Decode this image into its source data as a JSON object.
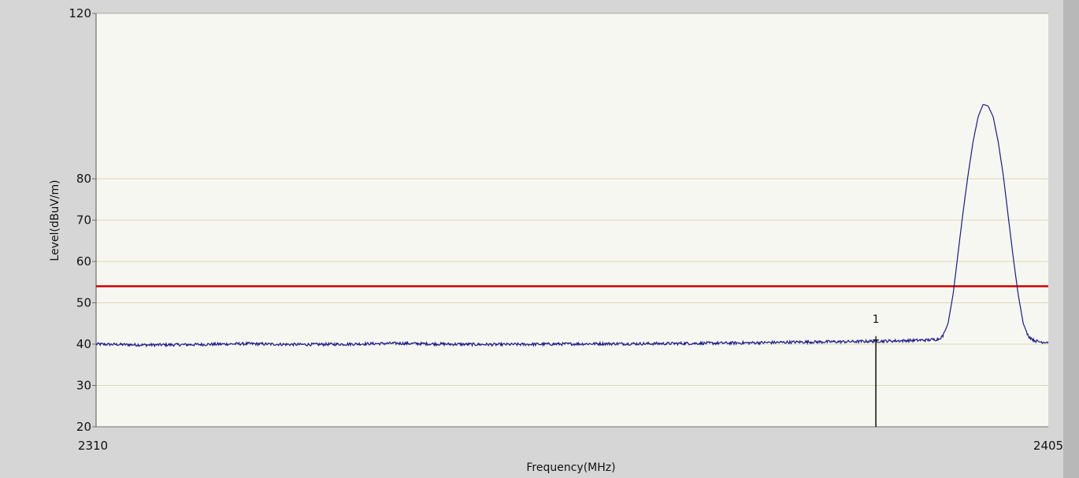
{
  "chart_data": {
    "type": "line",
    "title": "",
    "xlabel": "Frequency(MHz)",
    "ylabel": "Level(dBuV/m)",
    "xlim": [
      2310,
      2405
    ],
    "ylim": [
      20,
      120
    ],
    "x_ticks": [
      "2310",
      "2405"
    ],
    "y_ticks": [
      20,
      30,
      40,
      50,
      60,
      70,
      80,
      120
    ],
    "y_tick_labels": [
      "20",
      "30",
      "40",
      "50",
      "60",
      "70",
      "80",
      "120"
    ],
    "grid": true,
    "limit_line": {
      "y": 54,
      "color": "#cc0000"
    },
    "series": [
      {
        "color": "#1a1a8c",
        "x": [
          2310,
          2315,
          2320,
          2325,
          2330,
          2335,
          2340,
          2345,
          2350,
          2355,
          2360,
          2365,
          2370,
          2375,
          2380,
          2385,
          2390,
          2393,
          2394,
          2394.5,
          2395,
          2395.5,
          2396,
          2396.5,
          2397,
          2397.5,
          2398,
          2398.5,
          2399,
          2399.5,
          2400,
          2400.5,
          2401,
          2401.5,
          2402,
          2402.5,
          2403,
          2403.5,
          2404,
          2404.5,
          2405
        ],
        "y": [
          40.0,
          39.8,
          39.9,
          40.1,
          39.9,
          40.0,
          40.2,
          40.0,
          39.9,
          40.0,
          40.1,
          40.1,
          40.2,
          40.3,
          40.5,
          40.6,
          40.8,
          41.0,
          41.2,
          42.0,
          45.0,
          52.0,
          62.0,
          72.0,
          81.0,
          89.0,
          95.0,
          98.0,
          97.6,
          95.0,
          89.0,
          81.0,
          71.0,
          61.0,
          52.0,
          45.0,
          42.0,
          41.0,
          40.6,
          40.5,
          40.5
        ]
      }
    ],
    "markers": [
      {
        "label": "1",
        "x": 2387.8,
        "y": 41.0
      }
    ]
  },
  "colors": {
    "frame_background": "#d6d6d6",
    "plot_background": "#f7f7f2",
    "grid_line": "#d9d7b4",
    "axis_line": "#707070"
  }
}
